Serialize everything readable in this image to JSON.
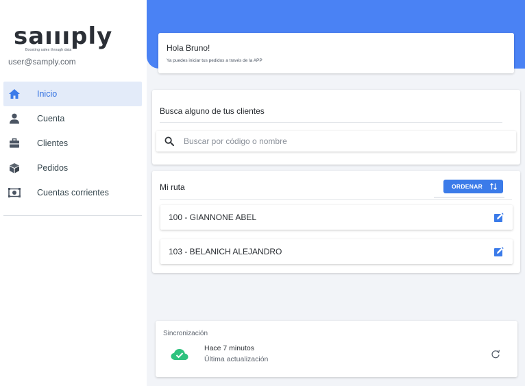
{
  "brand": {
    "logo_text": "saıııply",
    "tagline": "Boosting sales through data"
  },
  "user": {
    "email": "user@samply.com"
  },
  "nav": {
    "items": [
      {
        "label": "Inicio",
        "icon": "home-icon",
        "active": true
      },
      {
        "label": "Cuenta",
        "icon": "person-icon"
      },
      {
        "label": "Clientes",
        "icon": "briefcase-icon"
      },
      {
        "label": "Pedidos",
        "icon": "box-icon"
      },
      {
        "label": "Cuentas corrientes",
        "icon": "cash-icon"
      }
    ]
  },
  "greeting": {
    "title": "Hola Bruno!",
    "subtitle": "Ya puedes iniciar tus pedidos a través de la APP"
  },
  "search": {
    "title": "Busca alguno de tus clientes",
    "placeholder": "Buscar por código o nombre"
  },
  "route": {
    "title": "Mi ruta",
    "order_label": "ORDENAR",
    "clients": [
      {
        "name": "100 - GIANNONE ABEL"
      },
      {
        "name": "103 - BELANICH ALEJANDRO"
      }
    ]
  },
  "sync": {
    "title": "Sincronización",
    "time": "Hace 7 minutos",
    "caption": "Última actualización"
  },
  "colors": {
    "accent": "#4a82f4",
    "button": "#3b7be9",
    "active_bg": "#e3ebf9",
    "success": "#2ec27e"
  }
}
